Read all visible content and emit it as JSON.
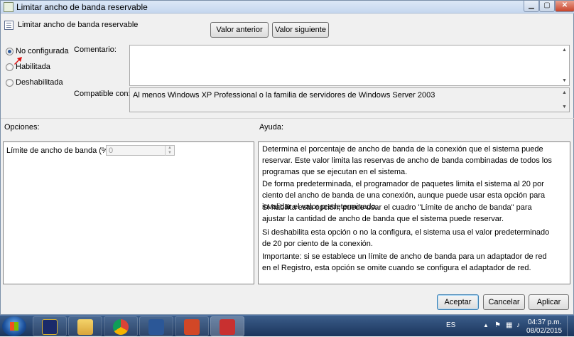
{
  "window": {
    "title": "Limitar ancho de banda reservable"
  },
  "header": {
    "policy_title": "Limitar ancho de banda reservable",
    "prev_label": "Valor anterior",
    "next_label": "Valor siguiente"
  },
  "state": {
    "options": [
      {
        "label": "No configurada",
        "selected": true
      },
      {
        "label": "Habilitada",
        "selected": false
      },
      {
        "label": "Deshabilitada",
        "selected": false
      }
    ]
  },
  "comment": {
    "label": "Comentario:",
    "value": ""
  },
  "compat": {
    "label": "Compatible con:",
    "value": "Al menos Windows XP Professional o la familia de servidores de Windows Server 2003"
  },
  "options_panel": {
    "title": "Opciones:",
    "field_label": "Límite de ancho de banda (%):",
    "field_value": "0"
  },
  "help": {
    "title": "Ayuda:",
    "paragraphs": [
      "Determina el porcentaje de ancho de banda de la conexión que el sistema puede reservar. Este valor limita las reservas de ancho de banda combinadas de todos los programas que se ejecutan en el sistema.",
      "De forma predeterminada, el programador de paquetes limita el sistema al 20 por ciento del ancho de banda de una conexión, aunque puede usar esta opción para invalidar el valor predeterminado.",
      "Si habilita esta opción, puede usar el cuadro \"Límite de ancho de banda\" para ajustar la cantidad de ancho de banda que el sistema puede reservar.",
      "Si deshabilita esta opción o no la configura, el sistema usa el valor predeterminado de 20 por ciento de la conexión.",
      "Importante: si se establece un límite de ancho de banda para un adaptador de red en el Registro, esta opción se omite cuando se configura el adaptador de red."
    ]
  },
  "footer": {
    "ok": "Aceptar",
    "cancel": "Cancelar",
    "apply": "Aplicar"
  },
  "taskbar": {
    "lang": "ES",
    "time": "04:37 p.m.",
    "date": "08/02/2015"
  },
  "colors": {
    "accent": "#2e5a9a",
    "close": "#c9452b",
    "taskbar": "#1b355c"
  }
}
